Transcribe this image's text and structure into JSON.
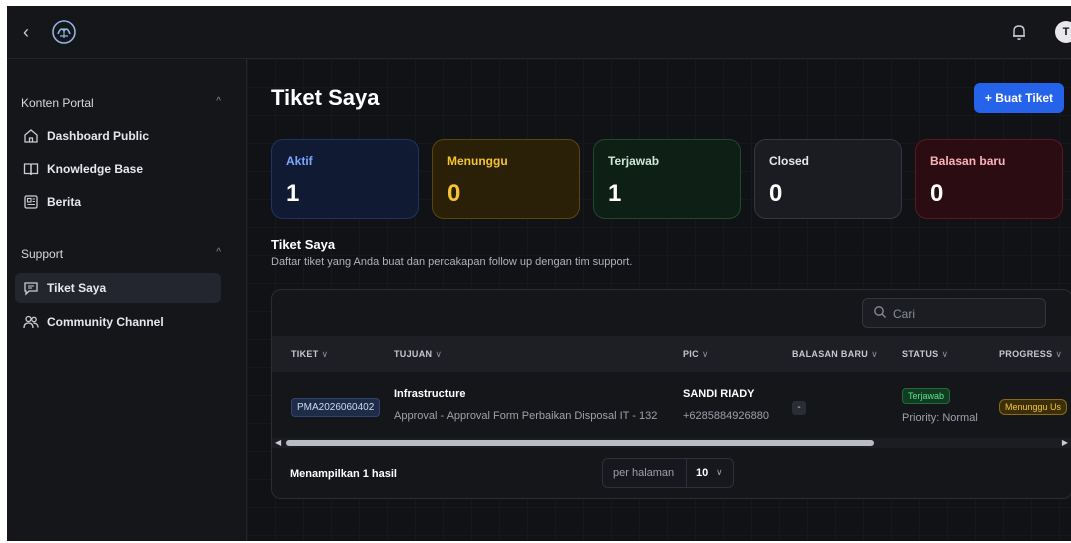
{
  "header": {
    "back_glyph": "‹",
    "avatar_initial": "T"
  },
  "sidebar": {
    "sections": [
      {
        "title": "Konten Portal",
        "items": [
          {
            "label": "Dashboard Public",
            "icon": "home-icon"
          },
          {
            "label": "Knowledge Base",
            "icon": "book-icon"
          },
          {
            "label": "Berita",
            "icon": "newspaper-icon"
          }
        ]
      },
      {
        "title": "Support",
        "items": [
          {
            "label": "Tiket Saya",
            "icon": "chat-icon",
            "active": true
          },
          {
            "label": "Community Channel",
            "icon": "users-icon"
          }
        ]
      }
    ],
    "chevron_glyph": "^"
  },
  "main": {
    "title": "Tiket Saya",
    "create_button": "+ Buat Tiket",
    "stats": [
      {
        "label": "Aktif",
        "value": "1",
        "color": "#7fa6ff",
        "bg": "#101a33",
        "border": "#1e3463"
      },
      {
        "label": "Menunggu",
        "value": "0",
        "color": "#f4c433",
        "bg": "#2a1f07",
        "border": "#5c4510"
      },
      {
        "label": "Terjawab",
        "value": "1",
        "color": "#cfe7d6",
        "bg": "#0e1f15",
        "border": "#1d4a2e"
      },
      {
        "label": "Closed",
        "value": "0",
        "color": "#e6e8ee",
        "bg": "#1a1c22",
        "border": "#34373f"
      },
      {
        "label": "Balasan baru",
        "value": "0",
        "color": "#ffb3b9",
        "bg": "#2a0c12",
        "border": "#5a1822"
      }
    ],
    "section_title": "Tiket Saya",
    "section_desc": "Daftar tiket yang Anda buat dan percakapan follow up dengan tim support.",
    "search_placeholder": "Cari",
    "table": {
      "columns": [
        "TIKET",
        "TUJUAN",
        "PIC",
        "BALASAN BARU",
        "STATUS",
        "PROGRESS"
      ],
      "sort_glyph": "∨",
      "rows": [
        {
          "ticket_id": "PMA2026060402",
          "tujuan_title": "Infrastructure",
          "tujuan_sub": "Approval - Approval Form Perbaikan Disposal IT - 132",
          "pic_name": "SANDI RIADY",
          "pic_phone": "+6285884926880",
          "balasan": "-",
          "status": "Terjawab",
          "priority": "Priority: Normal",
          "progress": "Menunggu Us"
        }
      ]
    },
    "footer_count": "Menampilkan 1 hasil",
    "per_page_label": "per halaman",
    "per_page_value": "10"
  }
}
